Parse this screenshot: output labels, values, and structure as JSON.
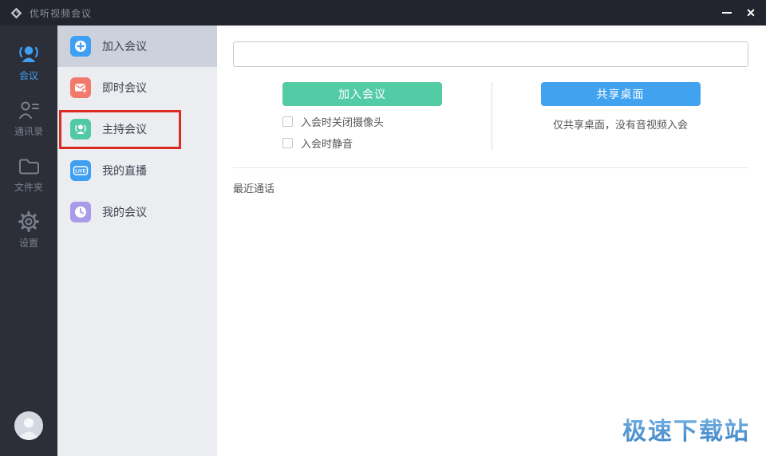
{
  "window": {
    "title": "优听视频会议",
    "close_label": "✕"
  },
  "nav": {
    "items": [
      {
        "label": "会议",
        "icon": "meeting-people-icon",
        "active": true
      },
      {
        "label": "通讯录",
        "icon": "contacts-icon",
        "active": false
      },
      {
        "label": "文件夹",
        "icon": "folder-icon",
        "active": false
      },
      {
        "label": "设置",
        "icon": "settings-gear-icon",
        "active": false
      }
    ]
  },
  "menu": {
    "items": [
      {
        "label": "加入会议",
        "icon": "join-meeting-icon",
        "selected": true,
        "annotated": false
      },
      {
        "label": "即时会议",
        "icon": "instant-meeting-icon",
        "selected": false,
        "annotated": false
      },
      {
        "label": "主持会议",
        "icon": "host-meeting-icon",
        "selected": false,
        "annotated": true
      },
      {
        "label": "我的直播",
        "icon": "live-icon",
        "selected": false,
        "annotated": false
      },
      {
        "label": "我的会议",
        "icon": "my-meetings-icon",
        "selected": false,
        "annotated": false
      }
    ]
  },
  "main": {
    "meeting_input": {
      "value": "",
      "placeholder": ""
    },
    "join_button": "加入会议",
    "share_button": "共享桌面",
    "checkboxes": [
      {
        "label": "入会时关闭摄像头",
        "checked": false
      },
      {
        "label": "入会时静音",
        "checked": false
      }
    ],
    "share_note": "仅共享桌面，没有音视频入会",
    "recent_calls_label": "最近通话"
  },
  "watermark": "极速下载站",
  "colors": {
    "titlebar-bg": "#22252d",
    "rail-bg": "#2c2f38",
    "accent-blue": "#3f9ff2",
    "menu-bg": "#ebedf1",
    "menu-selected-bg": "#cdd1db",
    "icon-coral": "#f3796d",
    "icon-green": "#52c9a3",
    "icon-purple": "#a89ce9",
    "btn-green": "#53cba5",
    "btn-blue": "#41a3f0",
    "annotation-red": "#dd2a23",
    "watermark-blue1": "#7db8e8",
    "watermark-blue2": "#3a80c4"
  }
}
